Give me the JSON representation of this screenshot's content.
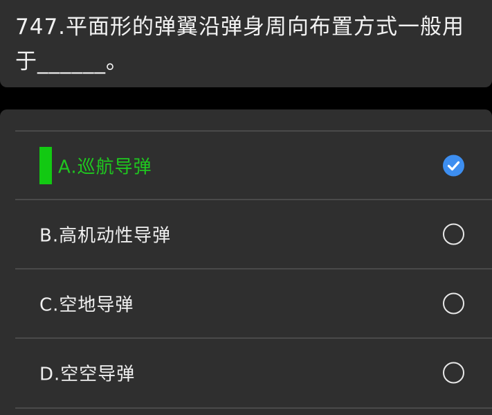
{
  "question": {
    "text": "747.平面形的弹翼沿弹身周向布置方式一般用于______。"
  },
  "options": [
    {
      "label": "A.巡航导弹",
      "selected": true
    },
    {
      "label": "B.高机动性导弹",
      "selected": false
    },
    {
      "label": "C.空地导弹",
      "selected": false
    },
    {
      "label": "D.空空导弹",
      "selected": false
    }
  ],
  "colors": {
    "selected_text": "#1fc81f",
    "selected_marker": "#12c912",
    "check_fill": "#3d8ef0",
    "card_bg": "#2f2f2f"
  },
  "icons": {
    "selected_radio": "check-icon",
    "unselected_radio": "radio-circle-icon"
  }
}
